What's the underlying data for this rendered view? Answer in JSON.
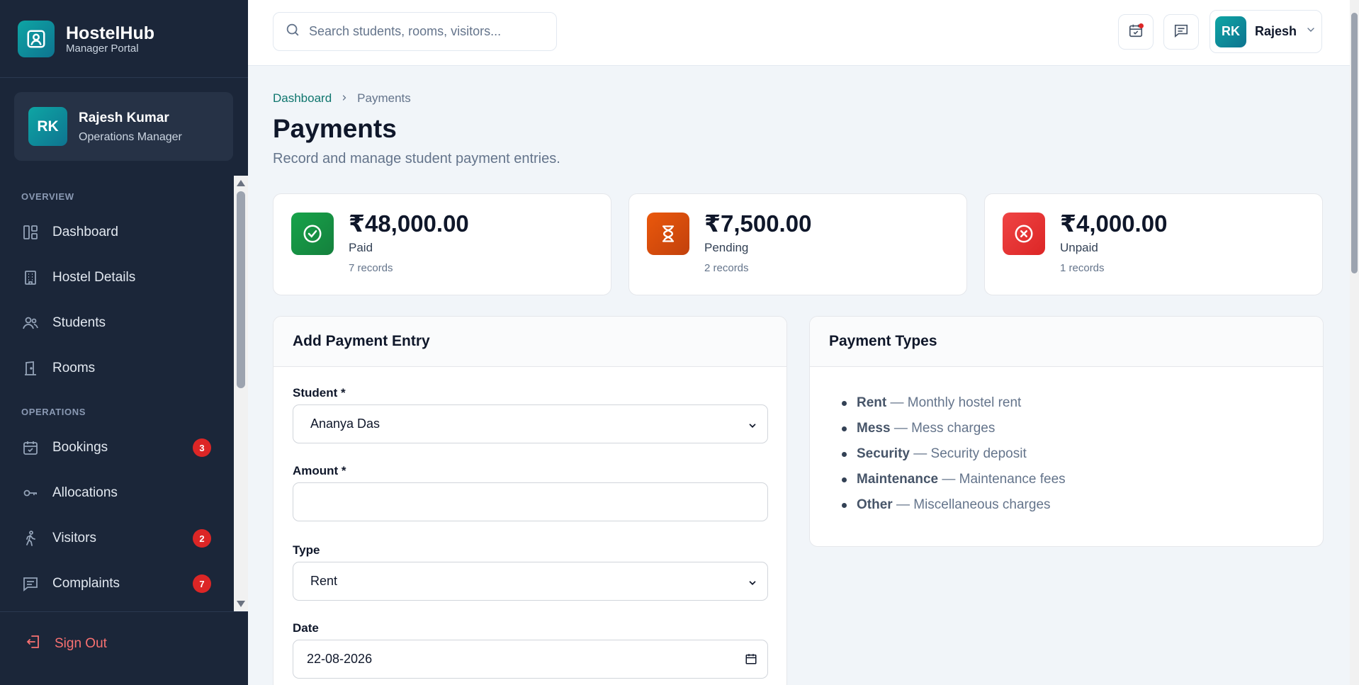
{
  "brand": {
    "name": "HostelHub",
    "subtitle": "Manager Portal"
  },
  "user": {
    "initials": "RK",
    "name": "Rajesh Kumar",
    "role": "Operations Manager"
  },
  "nav": {
    "overview_label": "OVERVIEW",
    "operations_label": "OPERATIONS",
    "items": [
      {
        "label": "Dashboard",
        "icon": "dashboard-icon"
      },
      {
        "label": "Hostel Details",
        "icon": "building-icon"
      },
      {
        "label": "Students",
        "icon": "users-icon"
      },
      {
        "label": "Rooms",
        "icon": "door-icon"
      },
      {
        "label": "Bookings",
        "icon": "calendar-check-icon",
        "badge": "3"
      },
      {
        "label": "Allocations",
        "icon": "key-icon"
      },
      {
        "label": "Visitors",
        "icon": "walking-icon",
        "badge": "2"
      },
      {
        "label": "Complaints",
        "icon": "message-icon",
        "badge": "7"
      }
    ],
    "sign_out": "Sign Out"
  },
  "topbar": {
    "search_placeholder": "Search students, rooms, visitors...",
    "profile_initials": "RK",
    "profile_name": "Rajesh"
  },
  "breadcrumb": {
    "root": "Dashboard",
    "current": "Payments"
  },
  "page": {
    "title": "Payments",
    "subtitle": "Record and manage student payment entries."
  },
  "stats": [
    {
      "value": "₹48,000.00",
      "label": "Paid",
      "count": "7 records",
      "color": "#15803d",
      "icon": "check-circle-icon"
    },
    {
      "value": "₹7,500.00",
      "label": "Pending",
      "count": "2 records",
      "color": "#c2410c",
      "icon": "hourglass-icon"
    },
    {
      "value": "₹4,000.00",
      "label": "Unpaid",
      "count": "1 records",
      "color": "#dc2626",
      "icon": "x-circle-icon"
    }
  ],
  "form": {
    "title": "Add Payment Entry",
    "student_label": "Student *",
    "student_value": "Ananya Das",
    "amount_label": "Amount *",
    "amount_value": "",
    "type_label": "Type",
    "type_value": "Rent",
    "date_label": "Date",
    "date_value": "22-08-2026"
  },
  "payment_types": {
    "title": "Payment Types",
    "items": [
      {
        "name": "Rent",
        "desc": "— Monthly hostel rent"
      },
      {
        "name": "Mess",
        "desc": "— Mess charges"
      },
      {
        "name": "Security",
        "desc": "— Security deposit"
      },
      {
        "name": "Maintenance",
        "desc": "— Maintenance fees"
      },
      {
        "name": "Other",
        "desc": "— Miscellaneous charges"
      }
    ]
  }
}
